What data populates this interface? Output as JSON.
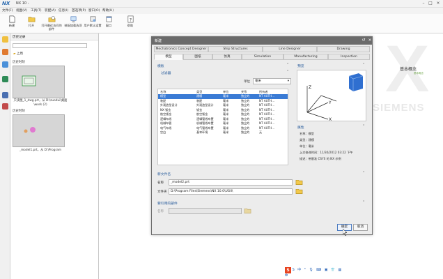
{
  "app": {
    "title": "NX 10 - ",
    "logo": "NX"
  },
  "window_controls": [
    "–",
    "□",
    "×"
  ],
  "menu": [
    "文件(F)",
    "视图(V)",
    "工具(T)",
    "装配(A)",
    "信息(I)",
    "首选项(P)",
    "窗口(O)",
    "帮助(H)"
  ],
  "ribbon": {
    "buttons": [
      {
        "label": "新建",
        "icon": "new-file-icon"
      },
      {
        "label": "打开",
        "icon": "open-folder-icon"
      },
      {
        "label": "打开最近访问的部件",
        "icon": "recent-parts-icon"
      },
      {
        "label": "装配加载选项",
        "icon": "assembly-load-icon"
      },
      {
        "label": "用户默认设置",
        "icon": "user-defaults-icon"
      },
      {
        "label": "窗口",
        "icon": "window-icon"
      },
      {
        "label": "帮助",
        "icon": "help-icon"
      }
    ]
  },
  "history": {
    "title": "历史记录",
    "up_label": "上周",
    "group1": "历史时刻",
    "item1_caption": "只读图_1_dwg.prt，从 D:\\zuodui\\桌面\\work (2)",
    "group2": "历史时刻",
    "item2_caption": "_model1.prt，从 D:\\Program"
  },
  "background": {
    "siemens": "SIEMENS",
    "concept": "基本概念",
    "concept_sub": "基本概念"
  },
  "dialog": {
    "title": "新建",
    "upper_tabs": [
      "Mechatronics Concept Designer",
      "Ship Structures",
      "Line Designer",
      "Drawing"
    ],
    "lower_tabs": [
      "模型",
      "图纸",
      "仿真",
      "Simulation",
      "Manufacturing",
      "Inspection"
    ],
    "templates_header": "模板",
    "filter_header": "过滤器",
    "unit_label": "单位",
    "unit_value": "毫米",
    "columns": [
      "名称",
      "类型",
      "单位",
      "关系",
      "所有者"
    ],
    "rows": [
      [
        "模型",
        "建模",
        "毫米",
        "独立的",
        "NT AUTH..."
      ],
      [
        "装配",
        "装配",
        "毫米",
        "独立的",
        "NT AUTH..."
      ],
      [
        "外观造型设计",
        "外观造型设计",
        "毫米",
        "独立的",
        "NT AUTH..."
      ],
      [
        "NX 钣金",
        "钣金",
        "毫米",
        "独立的",
        "NT AUTH..."
      ],
      [
        "航空钣金",
        "航空钣金",
        "毫米",
        "独立的",
        "NT AUTH..."
      ],
      [
        "逻辑布线",
        "逻辑管线布置",
        "毫米",
        "独立的",
        "NT AUTH..."
      ],
      [
        "机械布管",
        "机械管线布置",
        "毫米",
        "独立的",
        "NT AUTH..."
      ],
      [
        "电气布线",
        "电气管线布置",
        "毫米",
        "独立的",
        "NT AUTH..."
      ],
      [
        "空白",
        "基本环境",
        "毫米",
        "独立的",
        "无"
      ]
    ],
    "preview_header": "预览",
    "properties_header": "属性",
    "properties": [
      "名称：模型",
      "类型：建模",
      "单位：毫米",
      "上次修改时间：11/30/2012 03:22 下午",
      "描述：带基准 CSYS 的 NX 示例"
    ],
    "newfile_header": "新文件名",
    "name_label": "名称",
    "name_value": "_model2.prt",
    "folder_label": "文件夹",
    "folder_value": "D:\\Program Files\\Siemens\\NX 10.0\\UGII\\",
    "ref_header": "要引用的部件",
    "ref_name_label": "名称",
    "ok_label": "确定",
    "cancel_label": "取消"
  },
  "ime_bar": "S 中 ° 🎙 ⌨ ▣ 👕 ▦ ✿"
}
